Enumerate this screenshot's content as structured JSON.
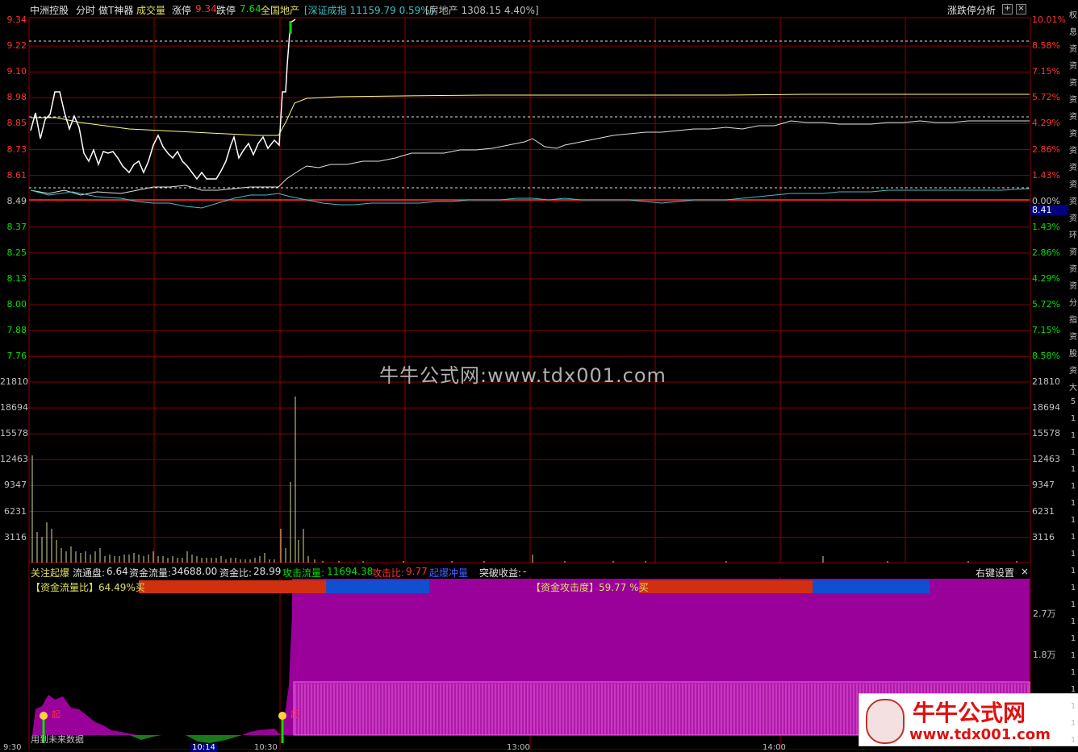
{
  "header": {
    "stock_name": "中洲控股",
    "view": "分时",
    "tool": "做T神器",
    "volume_label": "成交量",
    "limit_up_label": "涨停",
    "limit_up_value": "9.34",
    "limit_down_label": "跌停",
    "limit_down_value": "7.64",
    "sector": "全国地产",
    "index_quote": "[深证成指 11159.79 0.59%]",
    "sector_quote": "[房地产 1308.15 4.40%]",
    "right_label": "涨跌停分析",
    "plus_icon_text": "+",
    "close_icon_text": "×"
  },
  "price_axis": {
    "left": [
      "9.34",
      "9.22",
      "9.10",
      "8.98",
      "8.85",
      "8.73",
      "8.61",
      "8.49",
      "8.37",
      "8.25",
      "8.13",
      "8.00",
      "7.88",
      "7.76"
    ],
    "right": [
      "10.01%",
      "8.58%",
      "7.15%",
      "5.72%",
      "4.29%",
      "2.86%",
      "1.43%",
      "0.00%",
      "1.43%",
      "2.86%",
      "4.29%",
      "5.72%",
      "7.15%",
      "8.58%"
    ],
    "current_price_tag": "8.41",
    "prev_close": 8.49
  },
  "volume_axis": {
    "left": [
      "21810",
      "18694",
      "15578",
      "12463",
      "9347",
      "6231",
      "3116"
    ],
    "right": [
      "21810",
      "18694",
      "15578",
      "12463",
      "9347",
      "6231",
      "3116"
    ]
  },
  "indicator_bar": {
    "title": "关注起爆",
    "float_label": "流通盘:",
    "float_value": "6.64",
    "fund_flow_label": "资金流量:",
    "fund_flow_value": "34688.00",
    "fund_ratio_label": "资金比:",
    "fund_ratio_value": "28.99",
    "attack_flow_label": "攻击流量:",
    "attack_flow_value": "11694.38",
    "attack_ratio_label": "攻击比:",
    "attack_ratio_value": "9.77",
    "explosion_label": "起爆冲量",
    "breakthrough_label": "突破收益:",
    "breakthrough_value": "-",
    "settings_label": "右键设置",
    "close_text": "×"
  },
  "indicator_panel": {
    "flow_ratio_label": "【资金流量比】64.49%",
    "flow_ratio_suffix": "买",
    "flow_ratio_pct": 64.49,
    "attack_label": "【资金攻击度】59.77 %",
    "attack_suffix": "买",
    "attack_pct": 59.77,
    "axis_right": [
      "2.7万",
      "1.8万"
    ],
    "bottom_note": "用到未来数据",
    "marker_text": "起"
  },
  "time_axis": [
    "9:30",
    "10:14",
    "10:30",
    "13:00",
    "14:00"
  ],
  "watermark": "牛牛公式网:www.tdx001.com",
  "logo": {
    "title": "牛牛公式网",
    "url": "www.tdx001.com"
  },
  "sidebar_strip": [
    "权",
    "息",
    "资",
    "资",
    "资",
    "资",
    "资",
    "资",
    "资",
    "资",
    "资",
    "资",
    "资",
    "环",
    "资",
    "资",
    "资",
    "分",
    "指",
    "资",
    "股",
    "资",
    "大",
    "5",
    "1",
    "1",
    "1",
    "1",
    "1",
    "1",
    "1",
    "1",
    "1",
    "1",
    "1",
    "1",
    "1",
    "1",
    "1",
    "1",
    "1",
    "1",
    "1",
    "1"
  ],
  "colors": {
    "grid_red": "#8b0000",
    "up_red": "#ff3232",
    "down_green": "#00e000",
    "price_line": "#ffffff",
    "avg_line": "#ffff80",
    "index_line": "#e0e0e0",
    "cyan": "#40c0c0",
    "magenta_fill": "#9a009a",
    "bar_orange": "#d03010",
    "bar_blue": "#1050d0",
    "volume_bar": "#d8d8a0"
  }
}
